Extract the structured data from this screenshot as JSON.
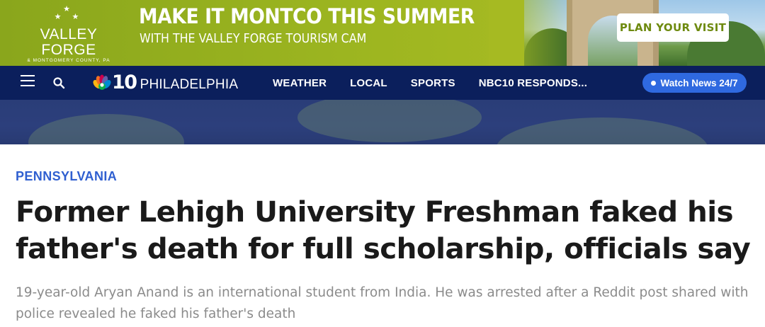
{
  "ad": {
    "brand_name": "VALLEY FORGE",
    "brand_sub": "& MONTGOMERY COUNTY, PA",
    "headline": "MAKE IT MONTCO THIS SUMMER",
    "subline": "WITH THE VALLEY FORGE TOURISM CAM",
    "cta_label": "PLAN YOUR VISIT",
    "background_color": "#9cb520",
    "cta_text_color": "#6e8a0f"
  },
  "nav": {
    "menu_icon": "hamburger-menu-icon",
    "search_icon": "search-icon",
    "logo_number": "10",
    "logo_city": "PHILADELPHIA",
    "links": [
      "WEATHER",
      "LOCAL",
      "SPORTS",
      "NBC10 RESPONDS..."
    ],
    "watch_label": "Watch News 24/7",
    "background_color": "#0b1f5c",
    "watch_color": "#2f69e0"
  },
  "article": {
    "category": "PENNSYLVANIA",
    "headline": "Former Lehigh University Freshman faked his father's death for full scholarship, officials say",
    "dek": "19-year-old Aryan Anand is an international student from India. He was arrested after a Reddit post shared with police revealed he faked his father's death",
    "category_color": "#2f5fd0"
  }
}
